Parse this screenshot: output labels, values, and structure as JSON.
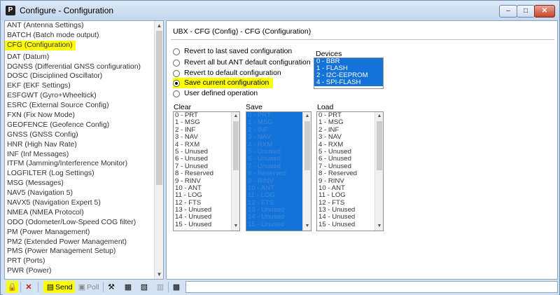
{
  "window": {
    "title": "Configure - Configuration",
    "app_icon": "P",
    "controls": {
      "minimize": "–",
      "maximize": "□",
      "close": "✕"
    }
  },
  "message_list": {
    "items": [
      "ANT (Antenna Settings)",
      "BATCH (Batch mode output)",
      "CFG (Configuration)",
      "DAT (Datum)",
      "DGNSS (Differential GNSS configuration)",
      "DOSC (Disciplined Oscillator)",
      "EKF (EKF Settings)",
      "ESFGWT (Gyro+Wheeltick)",
      "ESRC (External Source Config)",
      "FXN (Fix Now Mode)",
      "GEOFENCE (Geofence Config)",
      "GNSS (GNSS Config)",
      "HNR (High Nav Rate)",
      "INF (Inf Messages)",
      "ITFM (Jamming/Interference Monitor)",
      "LOGFILTER (Log Settings)",
      "MSG (Messages)",
      "NAV5 (Navigation 5)",
      "NAVX5 (Navigation Expert 5)",
      "NMEA (NMEA Protocol)",
      "ODO (Odometer/Low-Speed COG filter)",
      "PM (Power Management)",
      "PM2 (Extended Power Management)",
      "PMS (Power Management Setup)",
      "PRT (Ports)",
      "PWR (Power)"
    ],
    "selected": "CFG (Configuration)"
  },
  "panel": {
    "path": "UBX - CFG (Config) - CFG (Configuration)",
    "options": [
      {
        "label": "Revert to last saved configuration",
        "checked": false
      },
      {
        "label": "Revert all but ANT default configuration",
        "checked": false
      },
      {
        "label": "Revert to default configuration",
        "checked": false
      },
      {
        "label": "Save current configuration",
        "checked": true
      },
      {
        "label": "User defined operation",
        "checked": false
      }
    ],
    "devices_label": "Devices",
    "devices": [
      "0 - BBR",
      "1 - FLASH",
      "2 - I2C-EEPROM",
      "4 - SPI-FLASH"
    ],
    "clear_label": "Clear",
    "save_label": "Save",
    "load_label": "Load",
    "sections": [
      "0 - PRT",
      "1 - MSG",
      "2 - INF",
      "3 - NAV",
      "4 - RXM",
      "5 - Unused",
      "6 - Unused",
      "7 - Unused",
      "8 - Reserved",
      "9 - RINV",
      "10 - ANT",
      "11 - LOG",
      "12 - FTS",
      "13 - Unused",
      "14 - Unused",
      "15 - Unused"
    ]
  },
  "toolbar": {
    "send_label": "Send",
    "poll_label": "Poll"
  },
  "colors": {
    "highlight": "#ffff00",
    "selection_blue": "#1373d8",
    "green_mark": "#2f7d2f"
  }
}
